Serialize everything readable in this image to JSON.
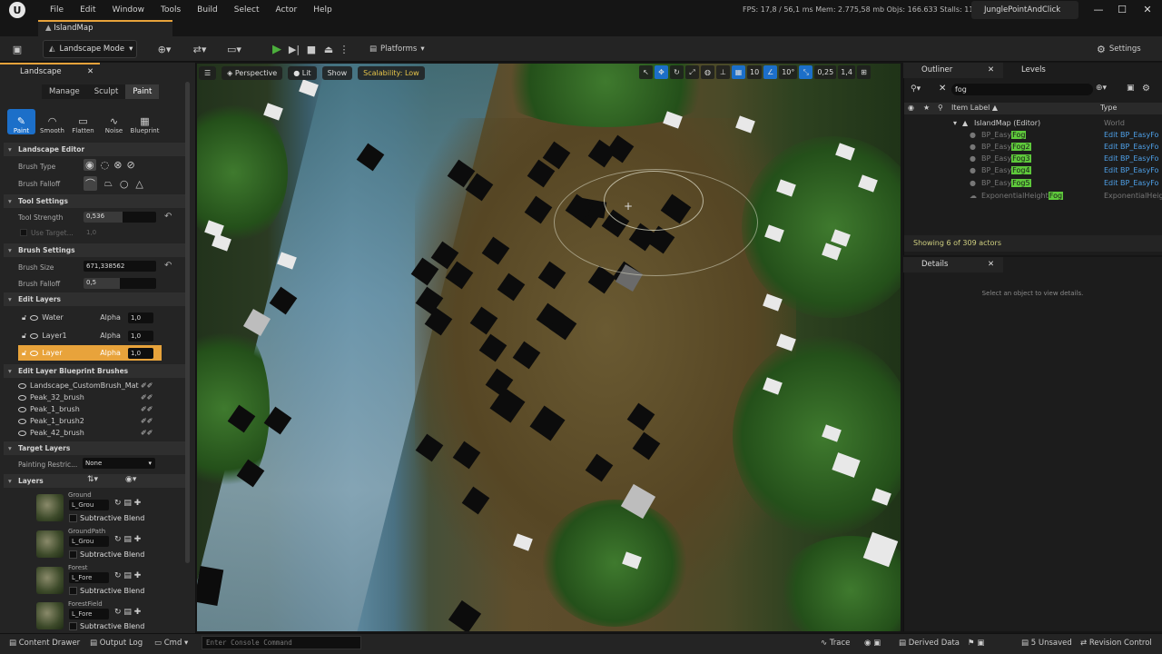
{
  "menubar": {
    "logo": "U",
    "items": [
      "File",
      "Edit",
      "Window",
      "Tools",
      "Build",
      "Select",
      "Actor",
      "Help"
    ],
    "stats": "FPS: 17,8  /  56,1 ms   Mem: 2.775,58 mb   Objs: 166.633   Stalls: 11",
    "project": "JunglePointAndClick",
    "win": [
      "—",
      "☐",
      "✕"
    ]
  },
  "tabs": {
    "map": "IslandMap"
  },
  "toolbar": {
    "mode": "Landscape Mode",
    "platforms": "Platforms",
    "settings": "Settings"
  },
  "landscape": {
    "tab": "Landscape",
    "modes": [
      "Manage",
      "Sculpt",
      "Paint"
    ],
    "tools": [
      "Paint",
      "Smooth",
      "Flatten",
      "Noise",
      "Blueprint"
    ],
    "sections": {
      "editor": "Landscape Editor",
      "tool_settings": "Tool Settings",
      "brush_settings": "Brush Settings",
      "edit_layers": "Edit Layers",
      "bp_brushes": "Edit Layer Blueprint Brushes",
      "target_layers": "Target Layers",
      "layers": "Layers"
    },
    "brush_type_label": "Brush Type",
    "brush_falloff_label": "Brush Falloff",
    "tool_strength_label": "Tool Strength",
    "tool_strength": "0,536",
    "tool_strength_fill": 0.536,
    "use_target_label": "Use Target...",
    "use_target_value": "1,0",
    "brush_size_label": "Brush Size",
    "brush_size": "671,338562",
    "brush_falloff2_label": "Brush Falloff",
    "brush_falloff2": "0,5",
    "brush_falloff2_fill": 0.5,
    "edit_layers": [
      {
        "name": "Water",
        "alpha_label": "Alpha",
        "alpha": "1,0"
      },
      {
        "name": "Layer1",
        "alpha_label": "Alpha",
        "alpha": "1,0"
      },
      {
        "name": "Layer",
        "alpha_label": "Alpha",
        "alpha": "1,0"
      }
    ],
    "bp_brushes": [
      "Landscape_CustomBrush_Mat",
      "Peak_32_brush",
      "Peak_1_brush",
      "Peak_1_brush2",
      "Peak_42_brush"
    ],
    "painting_restriction_label": "Painting Restric...",
    "painting_restriction": "None",
    "target_layers": [
      {
        "name": "Ground",
        "info": "L_Grou",
        "sub": "Subtractive Blend"
      },
      {
        "name": "GroundPath",
        "info": "L_Grou",
        "sub": "Subtractive Blend"
      },
      {
        "name": "Forest",
        "info": "L_Fore",
        "sub": "Subtractive Blend"
      },
      {
        "name": "ForestField",
        "info": "L_Fore",
        "sub": "Subtractive Blend"
      }
    ]
  },
  "viewport": {
    "perspective": "Perspective",
    "lit": "Lit",
    "show": "Show",
    "scalability": "Scalability: Low",
    "grid": "10",
    "angle": "10°",
    "scale": "0,25",
    "cam": "1,4"
  },
  "outliner": {
    "tab": "Outliner",
    "levels_tab": "Levels",
    "search": "fog",
    "col_label": "Item Label ▲",
    "col_type": "Type",
    "root": "IslandMap (Editor)",
    "root_type": "World",
    "rows": [
      {
        "pre": "BP_Easy",
        "hl": "Fog",
        "type": "Edit BP_EasyFo"
      },
      {
        "pre": "BP_Easy",
        "hl": "Fog2",
        "type": "Edit BP_EasyFo"
      },
      {
        "pre": "BP_Easy",
        "hl": "Fog3",
        "type": "Edit BP_EasyFo"
      },
      {
        "pre": "BP_Easy",
        "hl": "Fog4",
        "type": "Edit BP_EasyFo"
      },
      {
        "pre": "BP_Easy",
        "hl": "Fog5",
        "type": "Edit BP_EasyFo"
      },
      {
        "pre": "ExponentialHeight",
        "hl": "Fog",
        "type": "ExponentialHeig"
      }
    ],
    "showing": "Showing 6 of 309 actors"
  },
  "details": {
    "tab": "Details",
    "empty": "Select an object to view details."
  },
  "statusbar": {
    "content_drawer": "Content Drawer",
    "output_log": "Output Log",
    "cmd": "Cmd",
    "console_placeholder": "Enter Console Command",
    "trace": "Trace",
    "derived": "Derived Data",
    "unsaved": "5 Unsaved",
    "revision": "Revision Control"
  }
}
